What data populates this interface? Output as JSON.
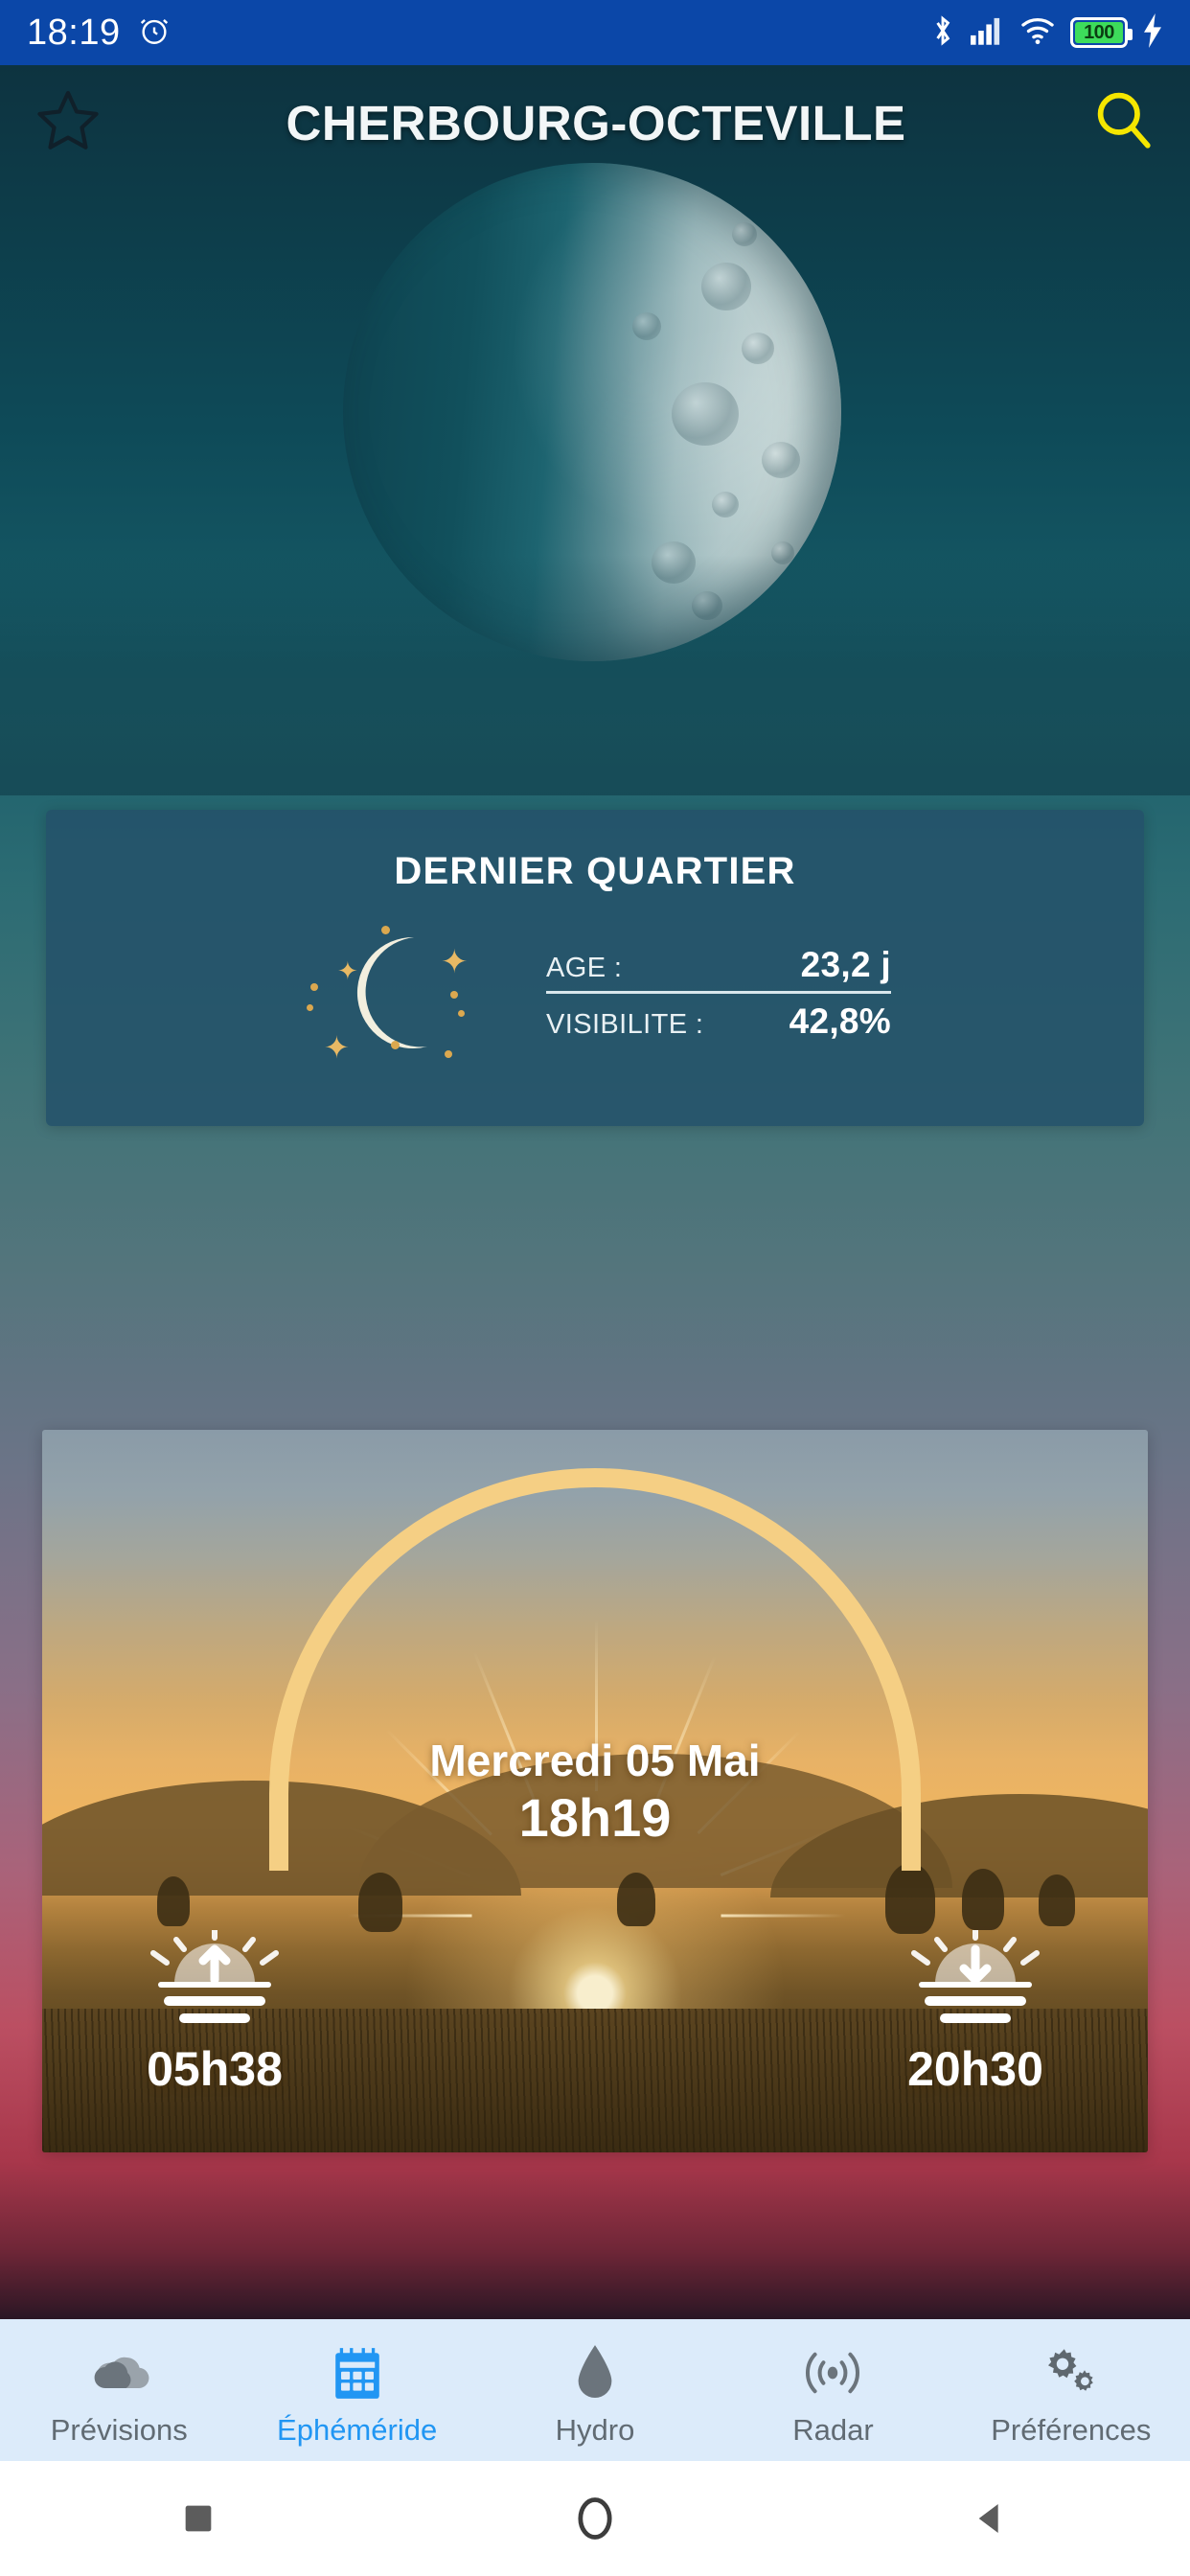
{
  "status_bar": {
    "time": "18:19",
    "icons": [
      "alarm-icon",
      "bluetooth-icon",
      "cellular-signal-icon",
      "wifi-icon",
      "battery-icon",
      "charging-bolt-icon"
    ],
    "battery_level": "100",
    "battery_color": "#3ddc5b",
    "background_color": "#0b47a8"
  },
  "header": {
    "title": "CHERBOURG-OCTEVILLE",
    "favorite_icon": "star-outline-icon",
    "search_icon": "search-icon",
    "search_icon_color": "#f5e600"
  },
  "moon_section": {
    "image_alt": "moon-photo",
    "phase_name": "DERNIER QUARTIER",
    "phase_icon": "crescent-moon-icon",
    "stats": [
      {
        "label": "AGE :",
        "value": "23,2 j"
      },
      {
        "label": "VISIBILITE :",
        "value": "42,8%"
      }
    ],
    "card_color": "#24526a"
  },
  "sun_section": {
    "image_alt": "sunrise-landscape-photo",
    "day_label": "Mercredi 05 Mai",
    "current_time": "18h19",
    "arc_color": "#f5cf84",
    "sunrise": {
      "icon": "sunrise-icon",
      "time": "05h38"
    },
    "sunset": {
      "icon": "sunset-icon",
      "time": "20h30"
    }
  },
  "bottom_nav": {
    "active_color": "#2196f3",
    "inactive_color": "#616b73",
    "background_color": "#dcebfa",
    "items": [
      {
        "label": "Prévisions",
        "icon": "cloud-icon",
        "active": false
      },
      {
        "label": "Éphéméride",
        "icon": "calendar-icon",
        "active": true
      },
      {
        "label": "Hydro",
        "icon": "water-drop-icon",
        "active": false
      },
      {
        "label": "Radar",
        "icon": "radar-waves-icon",
        "active": false
      },
      {
        "label": "Préférences",
        "icon": "gears-icon",
        "active": false
      }
    ]
  },
  "system_nav": {
    "buttons": [
      "recents-square-icon",
      "home-circle-icon",
      "back-triangle-icon"
    ]
  }
}
